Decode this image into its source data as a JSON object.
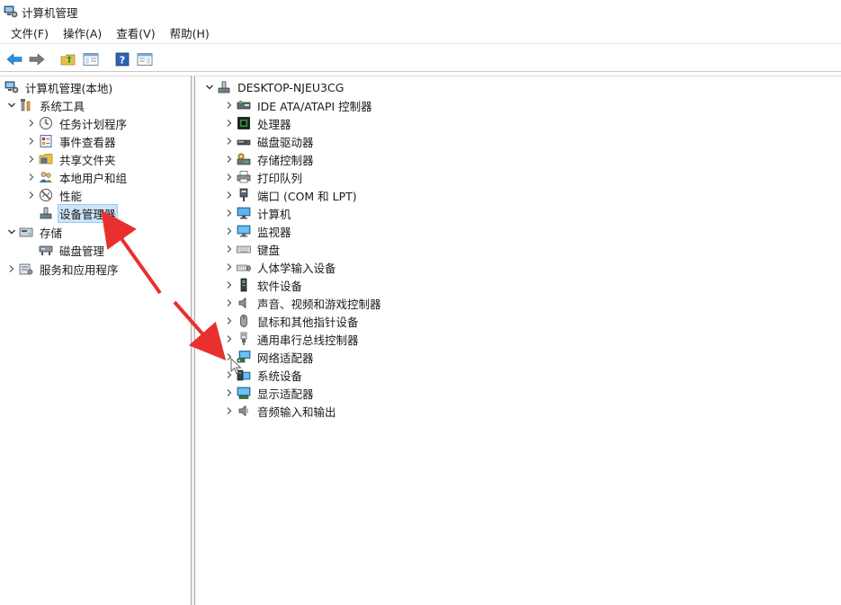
{
  "window": {
    "title": "计算机管理"
  },
  "menu": [
    {
      "label": "文件(F)"
    },
    {
      "label": "操作(A)"
    },
    {
      "label": "查看(V)"
    },
    {
      "label": "帮助(H)"
    }
  ],
  "toolbar": {
    "buttons": [
      {
        "icon": "back-arrow-icon"
      },
      {
        "icon": "forward-arrow-icon"
      },
      {
        "icon": "up-folder-icon"
      },
      {
        "icon": "show-hide-tree-icon"
      },
      {
        "icon": "help-icon"
      },
      {
        "icon": "properties-icon"
      }
    ]
  },
  "left_tree": [
    {
      "label": "计算机管理(本地)",
      "icon": "computer-management-icon",
      "chevron": ""
    },
    {
      "label": "系统工具",
      "icon": "system-tools-icon",
      "chevron": "down"
    },
    {
      "label": "任务计划程序",
      "icon": "task-scheduler-icon",
      "chevron": "right"
    },
    {
      "label": "事件查看器",
      "icon": "event-viewer-icon",
      "chevron": "right"
    },
    {
      "label": "共享文件夹",
      "icon": "shared-folder-icon",
      "chevron": "right"
    },
    {
      "label": "本地用户和组",
      "icon": "users-icon",
      "chevron": "right"
    },
    {
      "label": "性能",
      "icon": "performance-icon",
      "chevron": "right"
    },
    {
      "label": "设备管理器",
      "icon": "device-manager-icon",
      "chevron": "",
      "selected": true
    },
    {
      "label": "存储",
      "icon": "storage-icon",
      "chevron": "down"
    },
    {
      "label": "磁盘管理",
      "icon": "disk-management-icon",
      "chevron": ""
    },
    {
      "label": "服务和应用程序",
      "icon": "services-icon",
      "chevron": "right"
    }
  ],
  "device_tree": {
    "root": {
      "label": "DESKTOP-NJEU3CG",
      "icon": "computer-root-icon"
    },
    "categories": [
      {
        "label": "IDE ATA/ATAPI 控制器",
        "icon": "ide-controller-icon"
      },
      {
        "label": "处理器",
        "icon": "processor-icon"
      },
      {
        "label": "磁盘驱动器",
        "icon": "disk-drive-icon"
      },
      {
        "label": "存储控制器",
        "icon": "storage-controller-icon"
      },
      {
        "label": "打印队列",
        "icon": "printer-icon"
      },
      {
        "label": "端口 (COM 和 LPT)",
        "icon": "port-icon"
      },
      {
        "label": "计算机",
        "icon": "computer-icon"
      },
      {
        "label": "监视器",
        "icon": "monitor-icon"
      },
      {
        "label": "键盘",
        "icon": "keyboard-icon"
      },
      {
        "label": "人体学输入设备",
        "icon": "hid-icon"
      },
      {
        "label": "软件设备",
        "icon": "software-device-icon"
      },
      {
        "label": "声音、视频和游戏控制器",
        "icon": "sound-icon"
      },
      {
        "label": "鼠标和其他指针设备",
        "icon": "mouse-icon"
      },
      {
        "label": "通用串行总线控制器",
        "icon": "usb-icon"
      },
      {
        "label": "网络适配器",
        "icon": "network-adapter-icon"
      },
      {
        "label": "系统设备",
        "icon": "system-device-icon"
      },
      {
        "label": "显示适配器",
        "icon": "display-adapter-icon"
      },
      {
        "label": "音频输入和输出",
        "icon": "audio-io-icon"
      }
    ]
  },
  "colors": {
    "annotation_arrow": "#e8312f",
    "selection": "#cce4f7"
  }
}
